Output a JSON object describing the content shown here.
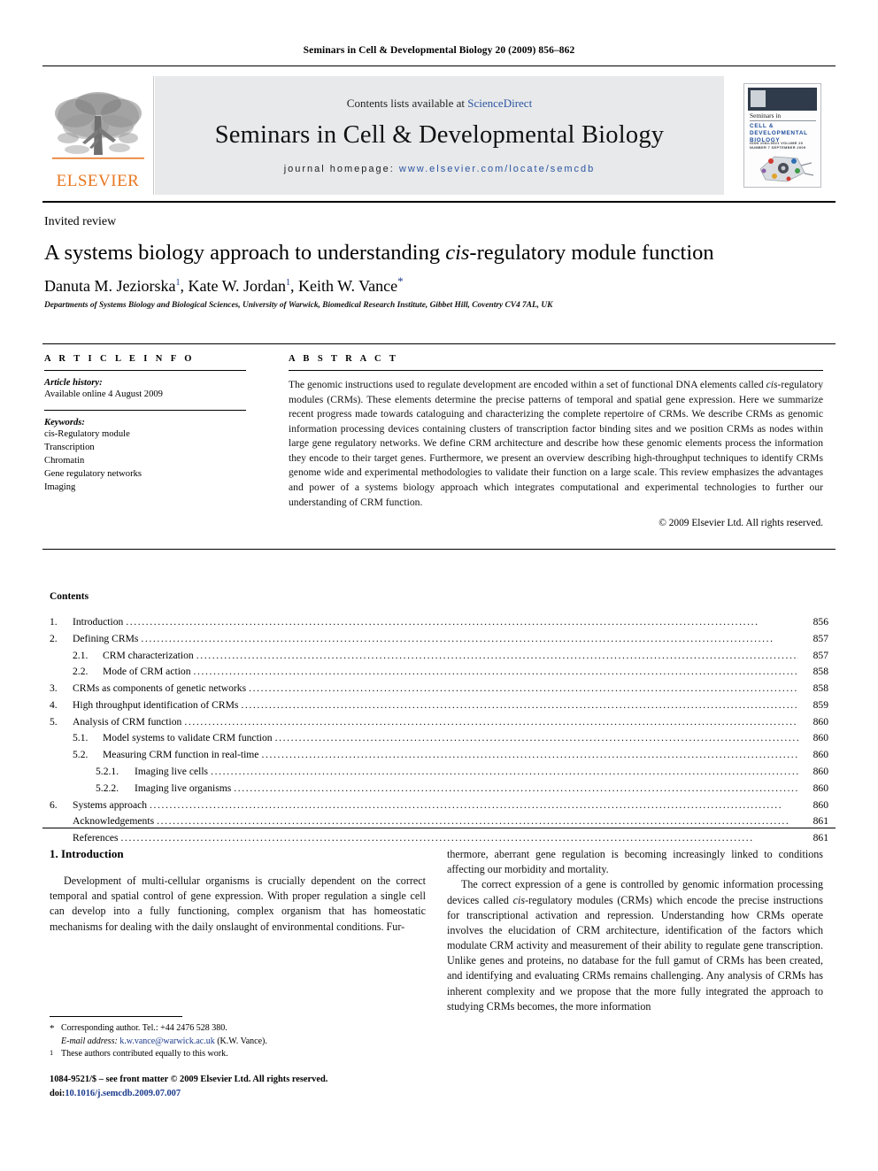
{
  "running_head": "Seminars in Cell & Developmental Biology 20 (2009) 856–862",
  "masthead": {
    "contents_prefix": "Contents lists available at ",
    "sciencedirect": "ScienceDirect",
    "journal_title": "Seminars in Cell & Developmental Biology",
    "homepage_label": "journal homepage:",
    "homepage_url": "www.elsevier.com/locate/semcdb",
    "publisher_wordmark": "ELSEVIER",
    "cover": {
      "line1": "Seminars in",
      "line2": "CELL & DEVELOPMENTAL BIOLOGY",
      "line3": "ISSN 1084-9521  VOLUME 20  NUMBER 7  SEPTEMBER 2009"
    },
    "accent_blue": "#2b55a3",
    "elsevier_orange": "#E87722"
  },
  "article": {
    "type": "Invited review",
    "title_part1": "A systems biology approach to understanding ",
    "title_italic": "cis",
    "title_part2": "-regulatory module function",
    "authors": [
      {
        "name": "Danuta M. Jeziorska",
        "sup": "1",
        "sep": ", "
      },
      {
        "name": "Kate W. Jordan",
        "sup": "1",
        "sep": ", "
      },
      {
        "name": "Keith W. Vance",
        "sup": "*",
        "sep": ""
      }
    ],
    "affiliation": "Departments of Systems Biology and Biological Sciences, University of Warwick, Biomedical Research Institute, Gibbet Hill, Coventry CV4 7AL, UK"
  },
  "article_info": {
    "heading": "A R T I C L E   I N F O",
    "history_label": "Article history:",
    "history_value": "Available online 4 August 2009",
    "keywords_label": "Keywords:",
    "keywords": [
      "cis-Regulatory module",
      "Transcription",
      "Chromatin",
      "Gene regulatory networks",
      "Imaging"
    ]
  },
  "abstract": {
    "heading": "A B S T R A C T",
    "text_1": "The genomic instructions used to regulate development are encoded within a set of functional DNA elements called ",
    "text_italic": "cis",
    "text_2": "-regulatory modules (CRMs). These elements determine the precise patterns of temporal and spatial gene expression. Here we summarize recent progress made towards cataloguing and characterizing the complete repertoire of CRMs. We describe CRMs as genomic information processing devices containing clusters of transcription factor binding sites and we position CRMs as nodes within large gene regulatory networks. We define CRM architecture and describe how these genomic elements process the information they encode to their target genes. Furthermore, we present an overview describing high-throughput techniques to identify CRMs genome wide and experimental methodologies to validate their function on a large scale. This review emphasizes the advantages and power of a systems biology approach which integrates computational and experimental technologies to further our understanding of CRM function.",
    "copyright": "© 2009 Elsevier Ltd. All rights reserved."
  },
  "contents": {
    "heading": "Contents",
    "entries": [
      {
        "level": 1,
        "number": "1.",
        "label": "Introduction",
        "page": "856"
      },
      {
        "level": 1,
        "number": "2.",
        "label": "Defining CRMs",
        "page": "857"
      },
      {
        "level": 2,
        "number": "2.1.",
        "label": "CRM characterization",
        "page": "857"
      },
      {
        "level": 2,
        "number": "2.2.",
        "label": "Mode of CRM action",
        "page": "858"
      },
      {
        "level": 1,
        "number": "3.",
        "label": "CRMs as components of genetic networks",
        "page": "858"
      },
      {
        "level": 1,
        "number": "4.",
        "label": "High throughput identification of CRMs",
        "page": "859"
      },
      {
        "level": 1,
        "number": "5.",
        "label": "Analysis of CRM function",
        "page": "860"
      },
      {
        "level": 2,
        "number": "5.1.",
        "label": "Model systems to validate CRM function",
        "page": "860"
      },
      {
        "level": 2,
        "number": "5.2.",
        "label": "Measuring CRM function in real-time",
        "page": "860"
      },
      {
        "level": 3,
        "number": "5.2.1.",
        "label": "Imaging live cells",
        "page": "860"
      },
      {
        "level": 3,
        "number": "5.2.2.",
        "label": "Imaging live organisms",
        "page": "860"
      },
      {
        "level": 1,
        "number": "6.",
        "label": "Systems approach",
        "page": "860"
      },
      {
        "level": 1,
        "number": "",
        "label": "Acknowledgements",
        "page": "861"
      },
      {
        "level": 1,
        "number": "",
        "label": "References",
        "page": "861"
      }
    ]
  },
  "body": {
    "section_heading": "1.  Introduction",
    "left_para_1": "Development of multi-cellular organisms is crucially dependent on the correct temporal and spatial control of gene expression. With proper regulation a single cell can develop into a fully functioning, complex organism that has homeostatic mechanisms for dealing with the daily onslaught of environmental conditions. Fur-",
    "right_para_1": "thermore, aberrant gene regulation is becoming increasingly linked to conditions affecting our morbidity and mortality.",
    "right_para_2a": "The correct expression of a gene is controlled by genomic information processing devices called ",
    "right_para_2_italic": "cis",
    "right_para_2b": "-regulatory modules (CRMs) which encode the precise instructions for transcriptional activation and repression. Understanding how CRMs operate involves the elucidation of CRM architecture, identification of the factors which modulate CRM activity and measurement of their ability to regulate gene transcription. Unlike genes and proteins, no database for the full gamut of CRMs has been created, and identifying and evaluating CRMs remains challenging. Any analysis of CRMs has inherent complexity and we propose that the more fully integrated the approach to studying CRMs becomes, the more information"
  },
  "footnotes": {
    "corresponding_mark": "*",
    "corresponding_text": "Corresponding author. Tel.: +44 2476 528 380.",
    "email_label": "E-mail address:",
    "email_value": "k.w.vance@warwick.ac.uk",
    "email_suffix": " (K.W. Vance).",
    "equal_mark": "1",
    "equal_text": "These authors contributed equally to this work."
  },
  "imprint": {
    "issn_line": "1084-9521/$ – see front matter © 2009 Elsevier Ltd. All rights reserved.",
    "doi_prefix": "doi:",
    "doi_value": "10.1016/j.semcdb.2009.07.007"
  }
}
